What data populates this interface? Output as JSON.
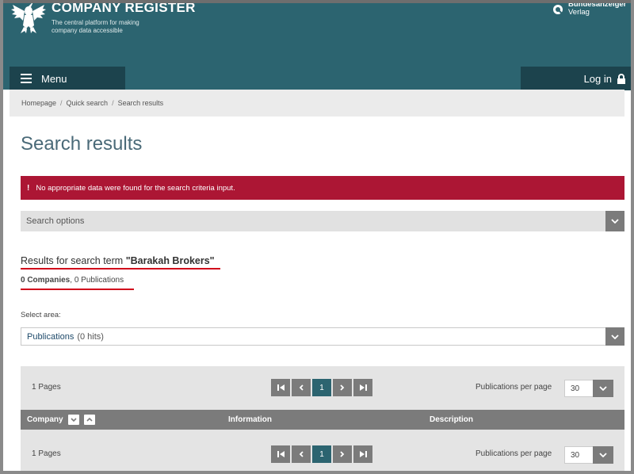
{
  "header": {
    "title": "COMPANY REGISTER",
    "subtitle_line1": "The central platform for making",
    "subtitle_line2": "company data accessible",
    "partner_top": "Bundesanzeiger",
    "partner_bottom": "Verlag"
  },
  "nav": {
    "menu_label": "Menu",
    "login_label": "Log in"
  },
  "breadcrumb": {
    "items": [
      "Homepage",
      "Quick search",
      "Search results"
    ],
    "separator": "/"
  },
  "page": {
    "title": "Search results"
  },
  "alert": {
    "icon": "!",
    "message": "No appropriate data were found for the search criteria input."
  },
  "search_options": {
    "label": "Search options"
  },
  "results": {
    "term_prefix": "Results for search term ",
    "term": "\"Barakah Brokers\"",
    "companies": "0 Companies",
    "publications": "0 Publications",
    "count_separator": ", "
  },
  "area": {
    "label": "Select area:",
    "selected": "Publications",
    "hits": "(0 hits)"
  },
  "pagination": {
    "pages_label": "1 Pages",
    "current_page": "1",
    "per_page_label": "Publications per page",
    "per_page_value": "30"
  },
  "table": {
    "columns": [
      "Company",
      "Information",
      "Description"
    ]
  },
  "colors": {
    "header_bg": "#2c6470",
    "nav_bg": "#1c434d",
    "alert_bg": "#ac1634",
    "highlight_underline": "#d0021b",
    "active_page": "#2c6470"
  }
}
